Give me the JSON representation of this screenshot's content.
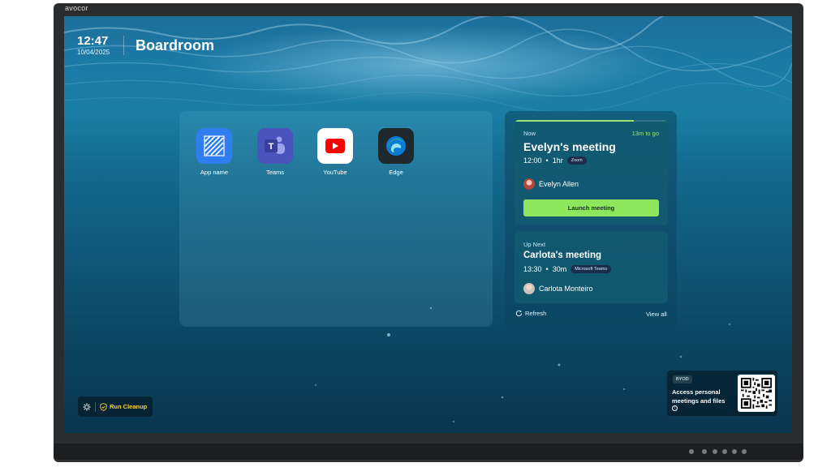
{
  "device": {
    "brand": "avocor"
  },
  "header": {
    "time": "12:47",
    "date": "10/04/2025",
    "room": "Boardroom"
  },
  "apps": [
    {
      "name": "App name",
      "icon": "striped-app-icon",
      "color": "#2e7ef0"
    },
    {
      "name": "Teams",
      "icon": "teams-icon",
      "color": "#4b53bc"
    },
    {
      "name": "YouTube",
      "icon": "youtube-icon",
      "color": "#ffffff"
    },
    {
      "name": "Edge",
      "icon": "edge-icon",
      "color": "#1f2a2f"
    }
  ],
  "meetings": {
    "now": {
      "status": "Now",
      "countdown": "13m to go",
      "progress": 0.78,
      "title": "Evelyn's meeting",
      "time": "12:00",
      "duration": "1hr",
      "platform": "Zoom",
      "host": "Evelyn Allen",
      "action": "Launch meeting"
    },
    "next": {
      "status": "Up Next",
      "title": "Carlota's meeting",
      "time": "13:30",
      "duration": "30m",
      "platform": "Microsoft Teams",
      "host": "Carlota Monteiro"
    },
    "refresh_label": "Refresh",
    "view_all_label": "View all"
  },
  "cleanup": {
    "label": "Run Cleanup"
  },
  "byod": {
    "badge": "BYOD",
    "text": "Access personal meetings and files",
    "info": "i"
  },
  "colors": {
    "accent_green": "#8ee65d",
    "cleanup_yellow": "#f5d33a"
  }
}
